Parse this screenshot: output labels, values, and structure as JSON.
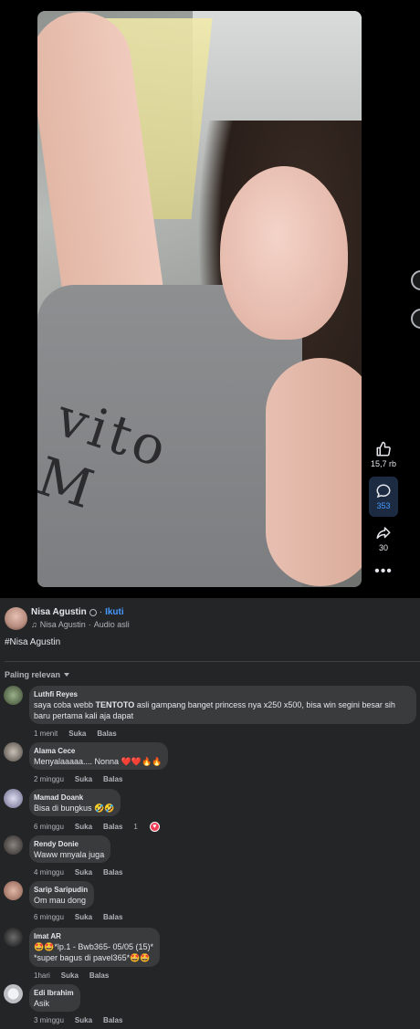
{
  "rail": {
    "likes": "15,7 rb",
    "comments": "353",
    "shares": "30"
  },
  "post": {
    "author": "Nisa Agustin",
    "follow_label": "Ikuti",
    "separator": "·",
    "audio_author": "Nisa Agustin",
    "audio_label": "Audio asli",
    "caption": "#Nisa Agustin"
  },
  "video": {
    "shirt_print": "vito M"
  },
  "sort_label": "Paling relevan",
  "actions": {
    "like": "Suka",
    "reply": "Balas"
  },
  "comments": [
    {
      "name": "Luthfi Reyes",
      "text_before": "saya coba webb ",
      "text_brand": "TENTOTO",
      "text_after": " asli gampang banget princess nya x250 x500, bisa win segini besar sih baru pertama kali aja dapat",
      "time": "1 menit"
    },
    {
      "name": "Alama Cece",
      "text": "Menyalaaaaa.... Nonna ❤️❤️🔥🔥",
      "time": "2 minggu"
    },
    {
      "name": "Mamad Doank",
      "text": "Bisa di bungkus 🤣🤣",
      "time": "6 minggu",
      "reactions": "1"
    },
    {
      "name": "Rendy Donie",
      "text": "Waww mnyala juga",
      "time": "4 minggu"
    },
    {
      "name": "Sarip Saripudin",
      "text": "Om mau dong",
      "time": "6 minggu"
    },
    {
      "name": "Imat AR",
      "line1": "🤩🤩*lp.1 - Bwb365- 05/05 (15)*",
      "line2": "*super bagus di pavel365*🤩🤩",
      "time": "1hari"
    },
    {
      "name": "Edi Ibrahim",
      "text": "Asik",
      "time": "3 minggu"
    }
  ],
  "colors": {
    "background": "#000000",
    "panel": "#242526",
    "bubble": "#3a3b3c",
    "accent": "#4599ff",
    "heart": "#f33e58"
  },
  "icons": [
    "like-icon",
    "comment-icon",
    "share-icon",
    "more-icon",
    "globe-icon",
    "music-note-icon",
    "caret-down-icon",
    "heart-icon"
  ]
}
